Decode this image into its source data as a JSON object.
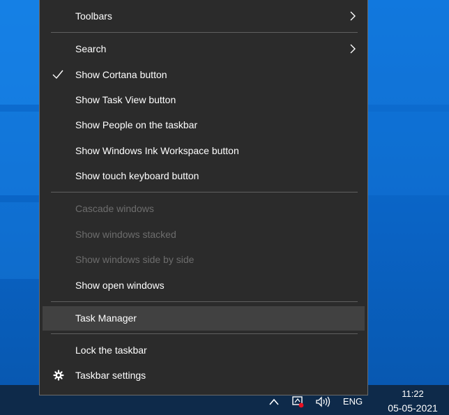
{
  "context_menu": {
    "items": [
      {
        "label": "Toolbars",
        "submenu": true,
        "enabled": true
      },
      {
        "label": "Search",
        "submenu": true,
        "enabled": true
      },
      {
        "label": "Show Cortana button",
        "checked": true,
        "enabled": true
      },
      {
        "label": "Show Task View button",
        "enabled": true
      },
      {
        "label": "Show People on the taskbar",
        "enabled": true
      },
      {
        "label": "Show Windows Ink Workspace button",
        "enabled": true
      },
      {
        "label": "Show touch keyboard button",
        "enabled": true
      },
      {
        "label": "Cascade windows",
        "enabled": false
      },
      {
        "label": "Show windows stacked",
        "enabled": false
      },
      {
        "label": "Show windows side by side",
        "enabled": false
      },
      {
        "label": "Show open windows",
        "enabled": true
      },
      {
        "label": "Task Manager",
        "enabled": true,
        "highlighted": true
      },
      {
        "label": "Lock the taskbar",
        "enabled": true
      },
      {
        "label": "Taskbar settings",
        "icon": "gear-icon",
        "enabled": true
      }
    ]
  },
  "tray": {
    "icons": [
      "chevron-up-icon",
      "network-icon",
      "volume-icon"
    ],
    "language": "ENG",
    "time": "11:22",
    "date": "05-05-2021"
  },
  "colors": {
    "desktop": "#0a63c4",
    "menu_bg": "#2b2b2b",
    "menu_highlight": "#414141",
    "disabled_text": "#6d6d6d",
    "taskbar": "#0e2a4a",
    "alert": "#e81123"
  }
}
